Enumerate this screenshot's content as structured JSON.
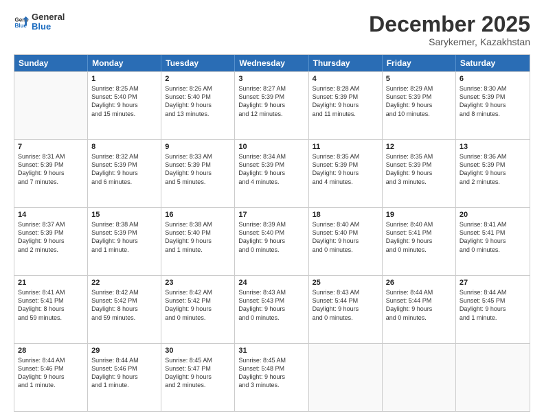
{
  "logo": {
    "general": "General",
    "blue": "Blue"
  },
  "header": {
    "month": "December 2025",
    "location": "Sarykemer, Kazakhstan"
  },
  "weekdays": [
    "Sunday",
    "Monday",
    "Tuesday",
    "Wednesday",
    "Thursday",
    "Friday",
    "Saturday"
  ],
  "rows": [
    [
      {
        "day": "",
        "lines": [],
        "empty": true
      },
      {
        "day": "1",
        "lines": [
          "Sunrise: 8:25 AM",
          "Sunset: 5:40 PM",
          "Daylight: 9 hours",
          "and 15 minutes."
        ]
      },
      {
        "day": "2",
        "lines": [
          "Sunrise: 8:26 AM",
          "Sunset: 5:40 PM",
          "Daylight: 9 hours",
          "and 13 minutes."
        ]
      },
      {
        "day": "3",
        "lines": [
          "Sunrise: 8:27 AM",
          "Sunset: 5:39 PM",
          "Daylight: 9 hours",
          "and 12 minutes."
        ]
      },
      {
        "day": "4",
        "lines": [
          "Sunrise: 8:28 AM",
          "Sunset: 5:39 PM",
          "Daylight: 9 hours",
          "and 11 minutes."
        ]
      },
      {
        "day": "5",
        "lines": [
          "Sunrise: 8:29 AM",
          "Sunset: 5:39 PM",
          "Daylight: 9 hours",
          "and 10 minutes."
        ]
      },
      {
        "day": "6",
        "lines": [
          "Sunrise: 8:30 AM",
          "Sunset: 5:39 PM",
          "Daylight: 9 hours",
          "and 8 minutes."
        ]
      }
    ],
    [
      {
        "day": "7",
        "lines": [
          "Sunrise: 8:31 AM",
          "Sunset: 5:39 PM",
          "Daylight: 9 hours",
          "and 7 minutes."
        ]
      },
      {
        "day": "8",
        "lines": [
          "Sunrise: 8:32 AM",
          "Sunset: 5:39 PM",
          "Daylight: 9 hours",
          "and 6 minutes."
        ]
      },
      {
        "day": "9",
        "lines": [
          "Sunrise: 8:33 AM",
          "Sunset: 5:39 PM",
          "Daylight: 9 hours",
          "and 5 minutes."
        ]
      },
      {
        "day": "10",
        "lines": [
          "Sunrise: 8:34 AM",
          "Sunset: 5:39 PM",
          "Daylight: 9 hours",
          "and 4 minutes."
        ]
      },
      {
        "day": "11",
        "lines": [
          "Sunrise: 8:35 AM",
          "Sunset: 5:39 PM",
          "Daylight: 9 hours",
          "and 4 minutes."
        ]
      },
      {
        "day": "12",
        "lines": [
          "Sunrise: 8:35 AM",
          "Sunset: 5:39 PM",
          "Daylight: 9 hours",
          "and 3 minutes."
        ]
      },
      {
        "day": "13",
        "lines": [
          "Sunrise: 8:36 AM",
          "Sunset: 5:39 PM",
          "Daylight: 9 hours",
          "and 2 minutes."
        ]
      }
    ],
    [
      {
        "day": "14",
        "lines": [
          "Sunrise: 8:37 AM",
          "Sunset: 5:39 PM",
          "Daylight: 9 hours",
          "and 2 minutes."
        ]
      },
      {
        "day": "15",
        "lines": [
          "Sunrise: 8:38 AM",
          "Sunset: 5:39 PM",
          "Daylight: 9 hours",
          "and 1 minute."
        ]
      },
      {
        "day": "16",
        "lines": [
          "Sunrise: 8:38 AM",
          "Sunset: 5:40 PM",
          "Daylight: 9 hours",
          "and 1 minute."
        ]
      },
      {
        "day": "17",
        "lines": [
          "Sunrise: 8:39 AM",
          "Sunset: 5:40 PM",
          "Daylight: 9 hours",
          "and 0 minutes."
        ]
      },
      {
        "day": "18",
        "lines": [
          "Sunrise: 8:40 AM",
          "Sunset: 5:40 PM",
          "Daylight: 9 hours",
          "and 0 minutes."
        ]
      },
      {
        "day": "19",
        "lines": [
          "Sunrise: 8:40 AM",
          "Sunset: 5:41 PM",
          "Daylight: 9 hours",
          "and 0 minutes."
        ]
      },
      {
        "day": "20",
        "lines": [
          "Sunrise: 8:41 AM",
          "Sunset: 5:41 PM",
          "Daylight: 9 hours",
          "and 0 minutes."
        ]
      }
    ],
    [
      {
        "day": "21",
        "lines": [
          "Sunrise: 8:41 AM",
          "Sunset: 5:41 PM",
          "Daylight: 8 hours",
          "and 59 minutes."
        ]
      },
      {
        "day": "22",
        "lines": [
          "Sunrise: 8:42 AM",
          "Sunset: 5:42 PM",
          "Daylight: 8 hours",
          "and 59 minutes."
        ]
      },
      {
        "day": "23",
        "lines": [
          "Sunrise: 8:42 AM",
          "Sunset: 5:42 PM",
          "Daylight: 9 hours",
          "and 0 minutes."
        ]
      },
      {
        "day": "24",
        "lines": [
          "Sunrise: 8:43 AM",
          "Sunset: 5:43 PM",
          "Daylight: 9 hours",
          "and 0 minutes."
        ]
      },
      {
        "day": "25",
        "lines": [
          "Sunrise: 8:43 AM",
          "Sunset: 5:44 PM",
          "Daylight: 9 hours",
          "and 0 minutes."
        ]
      },
      {
        "day": "26",
        "lines": [
          "Sunrise: 8:44 AM",
          "Sunset: 5:44 PM",
          "Daylight: 9 hours",
          "and 0 minutes."
        ]
      },
      {
        "day": "27",
        "lines": [
          "Sunrise: 8:44 AM",
          "Sunset: 5:45 PM",
          "Daylight: 9 hours",
          "and 1 minute."
        ]
      }
    ],
    [
      {
        "day": "28",
        "lines": [
          "Sunrise: 8:44 AM",
          "Sunset: 5:46 PM",
          "Daylight: 9 hours",
          "and 1 minute."
        ]
      },
      {
        "day": "29",
        "lines": [
          "Sunrise: 8:44 AM",
          "Sunset: 5:46 PM",
          "Daylight: 9 hours",
          "and 1 minute."
        ]
      },
      {
        "day": "30",
        "lines": [
          "Sunrise: 8:45 AM",
          "Sunset: 5:47 PM",
          "Daylight: 9 hours",
          "and 2 minutes."
        ]
      },
      {
        "day": "31",
        "lines": [
          "Sunrise: 8:45 AM",
          "Sunset: 5:48 PM",
          "Daylight: 9 hours",
          "and 3 minutes."
        ]
      },
      {
        "day": "",
        "lines": [],
        "empty": true
      },
      {
        "day": "",
        "lines": [],
        "empty": true
      },
      {
        "day": "",
        "lines": [],
        "empty": true
      }
    ]
  ]
}
